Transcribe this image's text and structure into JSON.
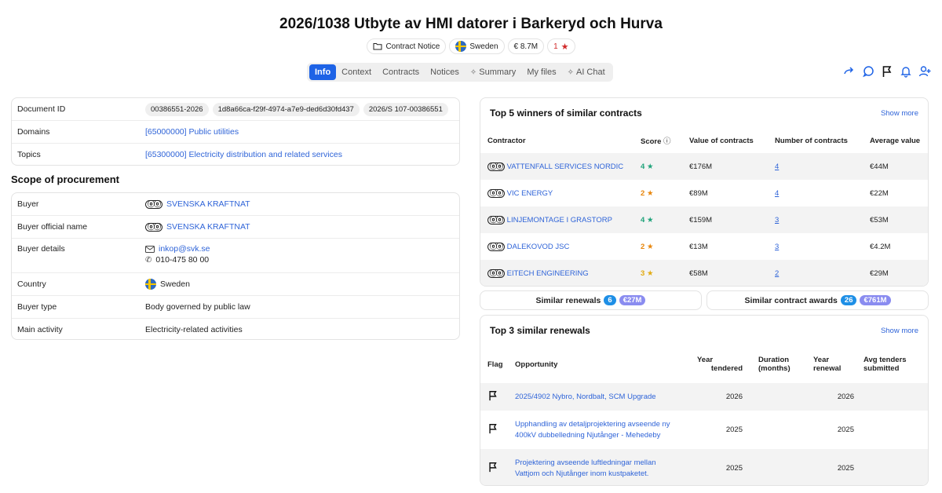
{
  "header": {
    "title": "2026/1038 Utbyte av HMI datorer i Barkeryd och Hurva",
    "chip_type": "Contract Notice",
    "chip_country": "Sweden",
    "chip_value": "€ 8.7M",
    "chip_rating": "1"
  },
  "tabs": [
    "Info",
    "Context",
    "Contracts",
    "Notices",
    "Summary",
    "My files",
    "AI Chat"
  ],
  "details": {
    "document_id_label": "Document ID",
    "document_ids": [
      "00386551-2026",
      "1d8a66ca-f29f-4974-a7e9-ded6d30fd437",
      "2026/S 107-00386551"
    ],
    "domains_label": "Domains",
    "domains_value": "[65000000] Public utilities",
    "topics_label": "Topics",
    "topics_value": "[65300000] Electricity distribution and related services"
  },
  "scope": {
    "title": "Scope of procurement",
    "buyer_label": "Buyer",
    "buyer_value": "SVENSKA KRAFTNAT",
    "official_label": "Buyer official name",
    "official_value": "SVENSKA KRAFTNAT",
    "details_label": "Buyer details",
    "email": "inkop@svk.se",
    "phone": "010-475 80 00",
    "country_label": "Country",
    "country_value": "Sweden",
    "type_label": "Buyer type",
    "type_value": "Body governed by public law",
    "activity_label": "Main activity",
    "activity_value": "Electricity-related activities"
  },
  "winners": {
    "title": "Top 5 winners of similar contracts",
    "show_more": "Show more",
    "headers": [
      "Contractor",
      "Score",
      "Value of contracts",
      "Number of contracts",
      "Average value"
    ],
    "rows": [
      {
        "name": "VATTENFALL SERVICES NORDIC",
        "score": "4",
        "value": "€176M",
        "count": "4",
        "avg": "€44M"
      },
      {
        "name": "VIC ENERGY",
        "score": "2",
        "value": "€89M",
        "count": "4",
        "avg": "€22M"
      },
      {
        "name": "LINJEMONTAGE I GRASTORP",
        "score": "4",
        "value": "€159M",
        "count": "3",
        "avg": "€53M"
      },
      {
        "name": "DALEKOVOD JSC",
        "score": "2",
        "value": "€13M",
        "count": "3",
        "avg": "€4.2M"
      },
      {
        "name": "EITECH ENGINEERING",
        "score": "3",
        "value": "€58M",
        "count": "2",
        "avg": "€29M"
      }
    ]
  },
  "similar": {
    "renewals_label": "Similar renewals",
    "renewals_count": "6",
    "renewals_value": "€27M",
    "awards_label": "Similar contract awards",
    "awards_count": "26",
    "awards_value": "€761M"
  },
  "renewals": {
    "title": "Top 3 similar renewals",
    "show_more": "Show more",
    "h_flag": "Flag",
    "h_opportunity": "Opportunity",
    "h_year_t1": "Year",
    "h_year_t2": "tendered",
    "h_dur1": "Duration",
    "h_dur2": "(months)",
    "h_year_r1": "Year",
    "h_year_r2": "renewal",
    "h_avg1": "Avg tenders",
    "h_avg2": "submitted",
    "rows": [
      {
        "l1": "2025/4902 Nybro, Nordbalt, SCM Upgrade",
        "l2": "",
        "year_t": "2026",
        "year_r": "2026"
      },
      {
        "l1": "Upphandling av detaljprojektering avseende ny",
        "l2": "400kV dubbelledning Njutånger - Mehedeby",
        "year_t": "2025",
        "year_r": "2025"
      },
      {
        "l1": "Projektering avseende luftledningar mellan",
        "l2": "Vattjom och Njutånger inom kustpaketet.",
        "year_t": "2025",
        "year_r": "2025"
      }
    ]
  }
}
